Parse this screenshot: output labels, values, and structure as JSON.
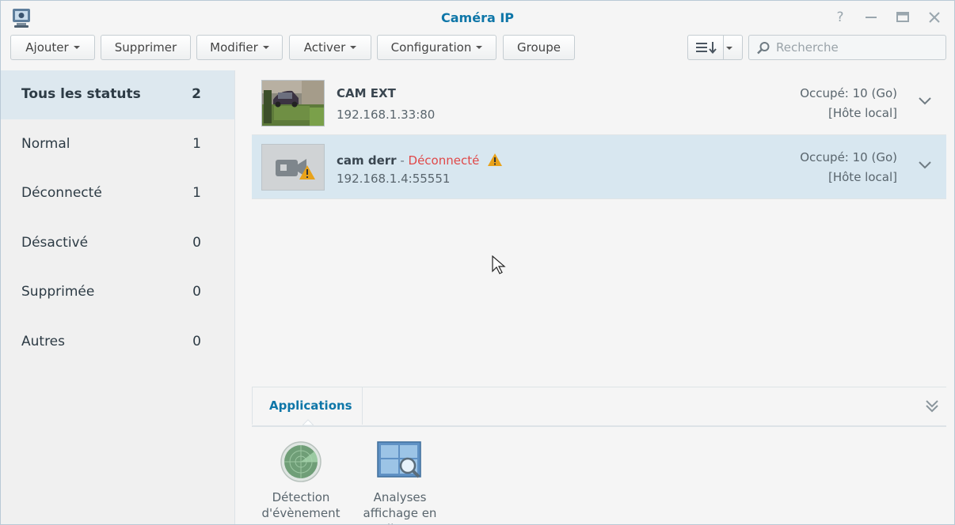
{
  "window": {
    "title": "Caméra IP"
  },
  "toolbar": {
    "add": "Ajouter",
    "delete": "Supprimer",
    "edit": "Modifier",
    "enable": "Activer",
    "configuration": "Configuration",
    "group": "Groupe",
    "search_placeholder": "Recherche"
  },
  "sidebar": {
    "items": [
      {
        "label": "Tous les statuts",
        "count": "2"
      },
      {
        "label": "Normal",
        "count": "1"
      },
      {
        "label": "Déconnecté",
        "count": "1"
      },
      {
        "label": "Désactivé",
        "count": "0"
      },
      {
        "label": "Supprimée",
        "count": "0"
      },
      {
        "label": "Autres",
        "count": "0"
      }
    ]
  },
  "cameras": [
    {
      "name": "CAM EXT",
      "status": "",
      "ip": "192.168.1.33:80",
      "used": "Occupé: 10 (Go)",
      "host": "[Hôte local]"
    },
    {
      "name": "cam derr",
      "separator": " - ",
      "status": "Déconnecté",
      "ip": "192.168.1.4:55551",
      "used": "Occupé: 10 (Go)",
      "host": "[Hôte local]"
    }
  ],
  "applications": {
    "tab": "Applications",
    "items": [
      {
        "label": "Détection d'évènement"
      },
      {
        "label": "Analyses affichage en direct"
      }
    ]
  },
  "colors": {
    "accent": "#0e76a8",
    "selected_row": "#d8e7f0",
    "status_error": "#e04848",
    "warning": "#e8a21a"
  }
}
